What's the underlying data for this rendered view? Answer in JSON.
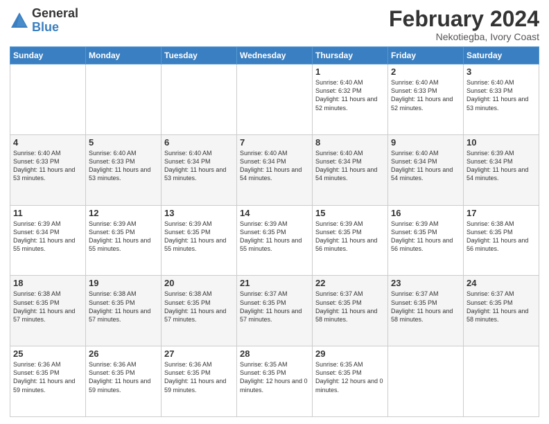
{
  "logo": {
    "general": "General",
    "blue": "Blue"
  },
  "header": {
    "month": "February 2024",
    "location": "Nekotiegba, Ivory Coast"
  },
  "weekdays": [
    "Sunday",
    "Monday",
    "Tuesday",
    "Wednesday",
    "Thursday",
    "Friday",
    "Saturday"
  ],
  "weeks": [
    [
      {
        "day": "",
        "info": ""
      },
      {
        "day": "",
        "info": ""
      },
      {
        "day": "",
        "info": ""
      },
      {
        "day": "",
        "info": ""
      },
      {
        "day": "1",
        "info": "Sunrise: 6:40 AM\nSunset: 6:32 PM\nDaylight: 11 hours and 52 minutes."
      },
      {
        "day": "2",
        "info": "Sunrise: 6:40 AM\nSunset: 6:33 PM\nDaylight: 11 hours and 52 minutes."
      },
      {
        "day": "3",
        "info": "Sunrise: 6:40 AM\nSunset: 6:33 PM\nDaylight: 11 hours and 53 minutes."
      }
    ],
    [
      {
        "day": "4",
        "info": "Sunrise: 6:40 AM\nSunset: 6:33 PM\nDaylight: 11 hours and 53 minutes."
      },
      {
        "day": "5",
        "info": "Sunrise: 6:40 AM\nSunset: 6:33 PM\nDaylight: 11 hours and 53 minutes."
      },
      {
        "day": "6",
        "info": "Sunrise: 6:40 AM\nSunset: 6:34 PM\nDaylight: 11 hours and 53 minutes."
      },
      {
        "day": "7",
        "info": "Sunrise: 6:40 AM\nSunset: 6:34 PM\nDaylight: 11 hours and 54 minutes."
      },
      {
        "day": "8",
        "info": "Sunrise: 6:40 AM\nSunset: 6:34 PM\nDaylight: 11 hours and 54 minutes."
      },
      {
        "day": "9",
        "info": "Sunrise: 6:40 AM\nSunset: 6:34 PM\nDaylight: 11 hours and 54 minutes."
      },
      {
        "day": "10",
        "info": "Sunrise: 6:39 AM\nSunset: 6:34 PM\nDaylight: 11 hours and 54 minutes."
      }
    ],
    [
      {
        "day": "11",
        "info": "Sunrise: 6:39 AM\nSunset: 6:34 PM\nDaylight: 11 hours and 55 minutes."
      },
      {
        "day": "12",
        "info": "Sunrise: 6:39 AM\nSunset: 6:35 PM\nDaylight: 11 hours and 55 minutes."
      },
      {
        "day": "13",
        "info": "Sunrise: 6:39 AM\nSunset: 6:35 PM\nDaylight: 11 hours and 55 minutes."
      },
      {
        "day": "14",
        "info": "Sunrise: 6:39 AM\nSunset: 6:35 PM\nDaylight: 11 hours and 55 minutes."
      },
      {
        "day": "15",
        "info": "Sunrise: 6:39 AM\nSunset: 6:35 PM\nDaylight: 11 hours and 56 minutes."
      },
      {
        "day": "16",
        "info": "Sunrise: 6:39 AM\nSunset: 6:35 PM\nDaylight: 11 hours and 56 minutes."
      },
      {
        "day": "17",
        "info": "Sunrise: 6:38 AM\nSunset: 6:35 PM\nDaylight: 11 hours and 56 minutes."
      }
    ],
    [
      {
        "day": "18",
        "info": "Sunrise: 6:38 AM\nSunset: 6:35 PM\nDaylight: 11 hours and 57 minutes."
      },
      {
        "day": "19",
        "info": "Sunrise: 6:38 AM\nSunset: 6:35 PM\nDaylight: 11 hours and 57 minutes."
      },
      {
        "day": "20",
        "info": "Sunrise: 6:38 AM\nSunset: 6:35 PM\nDaylight: 11 hours and 57 minutes."
      },
      {
        "day": "21",
        "info": "Sunrise: 6:37 AM\nSunset: 6:35 PM\nDaylight: 11 hours and 57 minutes."
      },
      {
        "day": "22",
        "info": "Sunrise: 6:37 AM\nSunset: 6:35 PM\nDaylight: 11 hours and 58 minutes."
      },
      {
        "day": "23",
        "info": "Sunrise: 6:37 AM\nSunset: 6:35 PM\nDaylight: 11 hours and 58 minutes."
      },
      {
        "day": "24",
        "info": "Sunrise: 6:37 AM\nSunset: 6:35 PM\nDaylight: 11 hours and 58 minutes."
      }
    ],
    [
      {
        "day": "25",
        "info": "Sunrise: 6:36 AM\nSunset: 6:35 PM\nDaylight: 11 hours and 59 minutes."
      },
      {
        "day": "26",
        "info": "Sunrise: 6:36 AM\nSunset: 6:35 PM\nDaylight: 11 hours and 59 minutes."
      },
      {
        "day": "27",
        "info": "Sunrise: 6:36 AM\nSunset: 6:35 PM\nDaylight: 11 hours and 59 minutes."
      },
      {
        "day": "28",
        "info": "Sunrise: 6:35 AM\nSunset: 6:35 PM\nDaylight: 12 hours and 0 minutes."
      },
      {
        "day": "29",
        "info": "Sunrise: 6:35 AM\nSunset: 6:35 PM\nDaylight: 12 hours and 0 minutes."
      },
      {
        "day": "",
        "info": ""
      },
      {
        "day": "",
        "info": ""
      }
    ]
  ]
}
